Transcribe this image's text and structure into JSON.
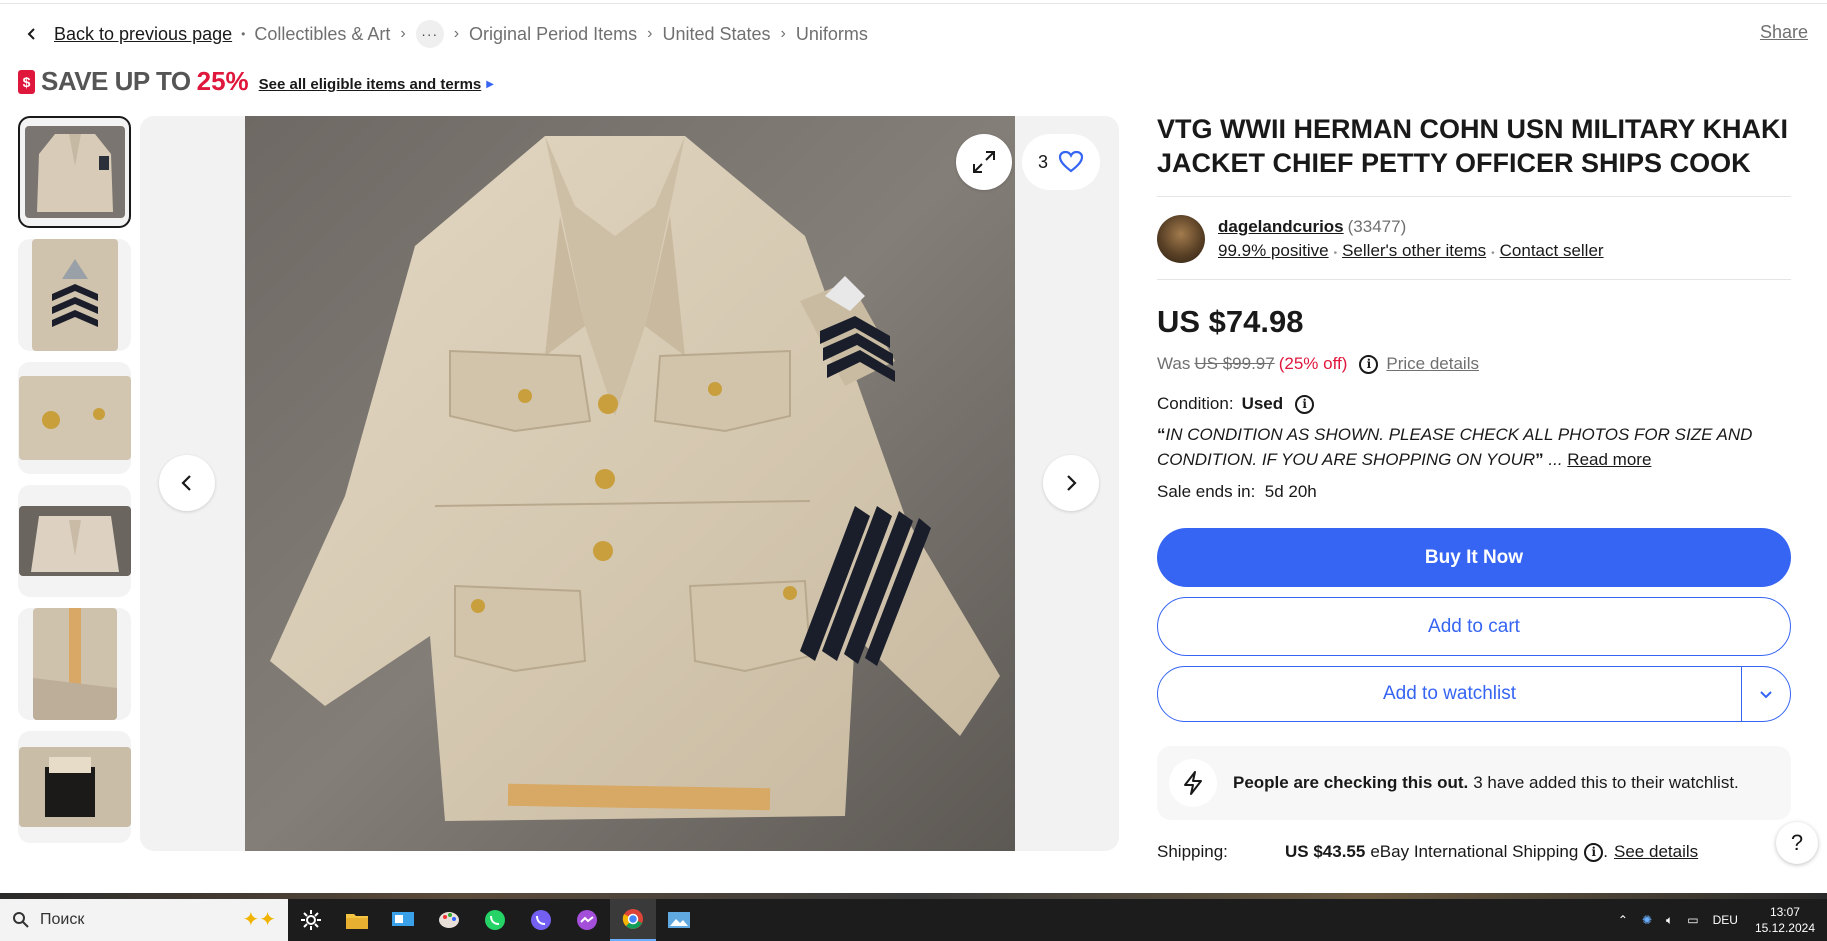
{
  "breadcrumb": {
    "back_label": "Back to previous page",
    "items": [
      "Collectibles & Art",
      "Original Period Items",
      "United States",
      "Uniforms"
    ],
    "more": "···"
  },
  "share_label": "Share",
  "promo": {
    "text": "SAVE UP TO",
    "percent": "25%",
    "link": "See all eligible items and terms"
  },
  "gallery": {
    "watch_count": "3",
    "thumbnails": [
      "jacket-front",
      "chevron-patch",
      "brass-buttons",
      "lining",
      "ruler-measure",
      "label"
    ]
  },
  "listing": {
    "title": "VTG WWII HERMAN COHN USN MILITARY KHAKI JACKET CHIEF PETTY OFFICER SHIPS COOK",
    "seller_name": "dagelandcurios",
    "seller_count": "(33477)",
    "feedback": "99.9% positive",
    "other_items": "Seller's other items",
    "contact": "Contact seller",
    "price": "US $74.98",
    "was_label": "Was",
    "was_price": "US $99.97",
    "discount": "(25% off)",
    "price_details": "Price details",
    "condition_label": "Condition:",
    "condition_value": "Used",
    "description": "IN CONDITION AS SHOWN. PLEASE CHECK ALL PHOTOS FOR SIZE AND CONDITION. IF YOU ARE SHOPPING ON YOUR",
    "read_more": "Read more",
    "sale_ends_label": "Sale ends in:",
    "sale_ends_value": "5d 20h",
    "buy_now": "Buy It Now",
    "add_to_cart": "Add to cart",
    "add_to_watchlist": "Add to watchlist",
    "notice_bold": "People are checking this out.",
    "notice_text": "3 have added this to their watchlist.",
    "shipping_label": "Shipping:",
    "shipping_price": "US $43.55",
    "shipping_method": "eBay International Shipping",
    "shipping_link": "See details"
  },
  "help_label": "?",
  "taskbar": {
    "search_placeholder": "Поиск",
    "lang": "DEU",
    "time": "13:07",
    "date": "15.12.2024"
  },
  "colors": {
    "accent_blue": "#3665f3",
    "sale_red": "#e0173c"
  }
}
